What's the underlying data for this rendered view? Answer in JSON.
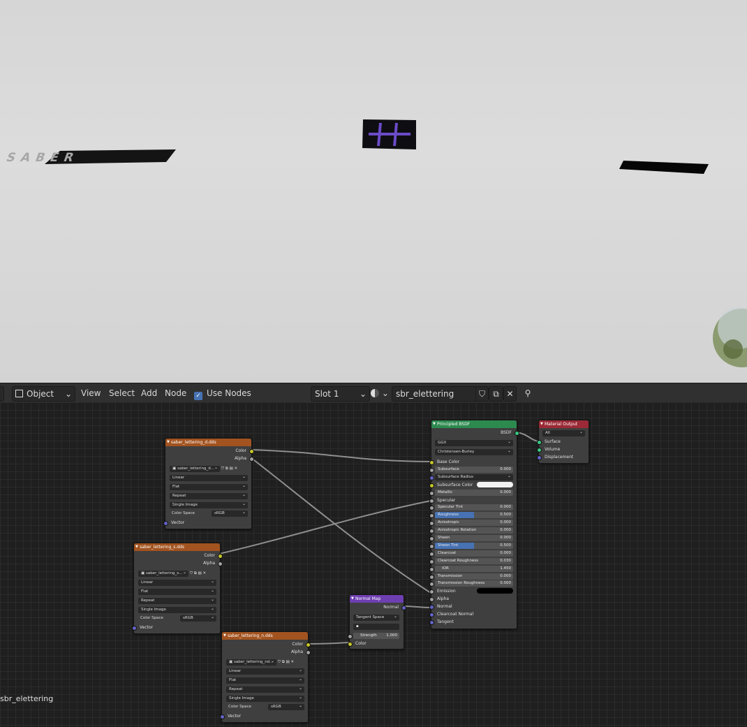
{
  "viewport": {
    "scene_objects": [
      "SABER"
    ]
  },
  "header": {
    "mode": "Object",
    "menus": [
      "View",
      "Select",
      "Add",
      "Node"
    ],
    "use_nodes_label": "Use Nodes",
    "slot": "Slot 1",
    "material": "sbr_elettering"
  },
  "nodes": {
    "diffuse": {
      "title": "saber_lettering_d.dds",
      "outputs": [
        "Color",
        "Alpha"
      ],
      "image": "saber_lettering_d...",
      "interpolation": "Linear",
      "projection": "Flat",
      "extension": "Repeat",
      "source": "Single Image",
      "colorspace_label": "Color Space",
      "colorspace": "sRGB",
      "vector": "Vector"
    },
    "specular": {
      "title": "saber_lettering_s.dds",
      "outputs": [
        "Color",
        "Alpha"
      ],
      "image": "saber_lettering_s...",
      "interpolation": "Linear",
      "projection": "Flat",
      "extension": "Repeat",
      "source": "Single Image",
      "colorspace_label": "Color Space",
      "colorspace": "sRGB",
      "vector": "Vector"
    },
    "normal_tex": {
      "title": "saber_lettering_n.dds",
      "outputs": [
        "Color",
        "Alpha"
      ],
      "image": "saber_lettering_nd...",
      "interpolation": "Linear",
      "projection": "Flat",
      "extension": "Repeat",
      "source": "Single Image",
      "colorspace_label": "Color Space",
      "colorspace": "sRGB",
      "vector": "Vector"
    },
    "normal_map": {
      "title": "Normal Map",
      "output": "Normal",
      "space": "Tangent Space",
      "uv": "",
      "strength_label": "Strength",
      "strength": "1.000",
      "color": "Color"
    },
    "bsdf": {
      "title": "Principled BSDF",
      "output": "BSDF",
      "distribution": "GGX",
      "subsurface_method": "Christensen-Burley",
      "inputs": [
        {
          "label": "Base Color",
          "type": "socket"
        },
        {
          "label": "Subsurface",
          "value": "0.000"
        },
        {
          "label": "Subsurface Radius",
          "type": "select"
        },
        {
          "label": "Subsurface Color",
          "type": "color",
          "color": "#f2f2f2"
        },
        {
          "label": "Metallic",
          "value": "0.000"
        },
        {
          "label": "Specular",
          "type": "socket"
        },
        {
          "label": "Specular Tint",
          "value": "0.000"
        },
        {
          "label": "Roughness",
          "value": "0.500",
          "fill": 0.5
        },
        {
          "label": "Anisotropic",
          "value": "0.000"
        },
        {
          "label": "Anisotropic Rotation",
          "value": "0.000"
        },
        {
          "label": "Sheen",
          "value": "0.000"
        },
        {
          "label": "Sheen Tint",
          "value": "0.500",
          "fill": 0.5
        },
        {
          "label": "Clearcoat",
          "value": "0.000"
        },
        {
          "label": "Clearcoat Roughness",
          "value": "0.030"
        },
        {
          "label": "IOR",
          "value": "1.450",
          "center": true
        },
        {
          "label": "Transmission",
          "value": "0.000"
        },
        {
          "label": "Transmission Roughness",
          "value": "0.000"
        },
        {
          "label": "Emission",
          "type": "color",
          "color": "#000000"
        },
        {
          "label": "Alpha",
          "type": "socket"
        },
        {
          "label": "Normal",
          "type": "socket"
        },
        {
          "label": "Clearcoat Normal",
          "type": "socket"
        },
        {
          "label": "Tangent",
          "type": "socket"
        }
      ]
    },
    "output": {
      "title": "Material Output",
      "target": "All",
      "inputs": [
        "Surface",
        "Volume",
        "Displacement"
      ]
    }
  },
  "bottom_label": "sbr_elettering"
}
